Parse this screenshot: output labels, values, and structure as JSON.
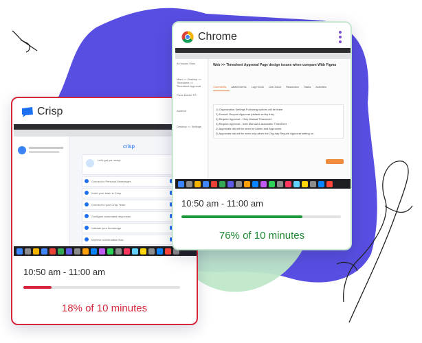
{
  "crisp_card": {
    "app_name": "Crisp",
    "time_range": "10:50 am - 11:00 am",
    "progress_label": "18% of 10 minutes",
    "progress_fraction": 0.18,
    "accent_color": "#d6263a",
    "icon": "crisp-chat-icon",
    "screenshot": {
      "brand": "crisp",
      "welcome": "Let's get you setup",
      "tasks": [
        "Connect to Personal Messenger",
        "Invite your team in Crisp",
        "Connect to your Crisp Team",
        "Configure automated responses",
        "Validate your knowledge",
        "Improve conversation flow"
      ]
    }
  },
  "chrome_card": {
    "app_name": "Chrome",
    "time_range": "10:50 am - 11:00 am",
    "progress_label": "76% of 10 minutes",
    "progress_fraction": 0.76,
    "accent_color": "#1a9a3a",
    "icon": "chrome-logo-icon",
    "menu_icon": "kebab-menu-icon",
    "screenshot": {
      "issue_title": "Web >> Timesheet Approval Page design issues when compare With Figma",
      "tabs": [
        "Comments",
        "Attachments",
        "Log Hours",
        "Link Issue",
        "Resolution",
        "Tasks",
        "Activities"
      ],
      "sidebar_items": [
        "All Issues View",
        "Main >> Desktop >> Timesheet >> Timesheet Approval",
        "Fixes Mobile TS",
        "Andriod",
        "Desktop >> Settings"
      ],
      "notes": [
        "1) Organization Settings Following options will be there",
        "2) Doesn't Require Approval (default set by this)",
        "3) Require Approval - Only Manual Timesheet",
        "4) Require Approval - both Manual & Automatic Timesheet",
        "2) Approvals tab will be seen by Admin and Approvers",
        "3) Approvals tab will be seen only when the Org has Require Approval setting on"
      ]
    }
  }
}
